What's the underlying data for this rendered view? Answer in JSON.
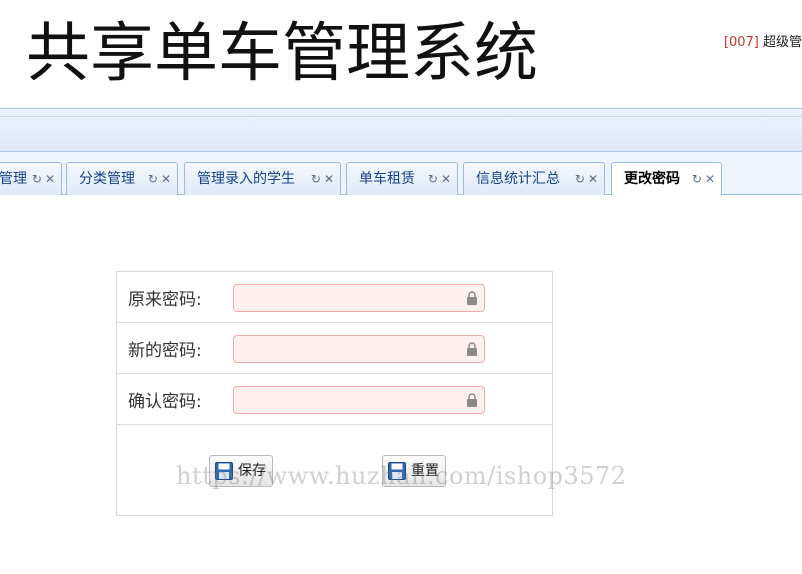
{
  "header": {
    "title": "共享单车管理系统",
    "user_id": "[007]",
    "user_role": "超级管"
  },
  "tabs": [
    {
      "label": "管理"
    },
    {
      "label": "分类管理"
    },
    {
      "label": "管理录入的学生"
    },
    {
      "label": "单车租赁"
    },
    {
      "label": "信息统计汇总"
    },
    {
      "label": "更改密码",
      "active": true
    }
  ],
  "tab_icons": {
    "refresh": "↻",
    "close": "✕"
  },
  "form": {
    "old_password_label": "原来密码:",
    "new_password_label": "新的密码:",
    "confirm_password_label": "确认密码:",
    "save_label": "保存",
    "reset_label": "重置"
  },
  "watermark": "https://www.huzhan.com/ishop3572",
  "colors": {
    "accent": "#15428b",
    "input_error_bg": "#fff0f0",
    "input_error_border": "#f2a8a8"
  }
}
